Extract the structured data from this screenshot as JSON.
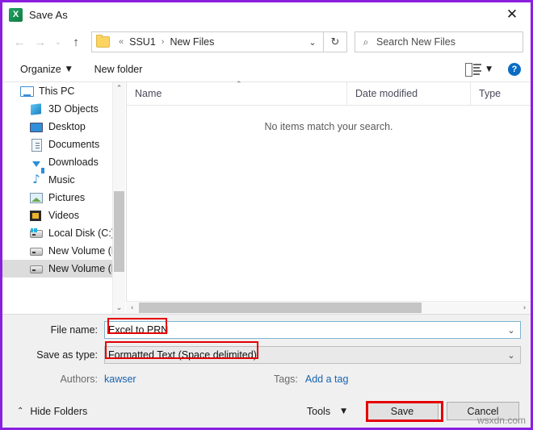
{
  "window": {
    "title": "Save As",
    "app_icon": "excel-icon",
    "app_icon_letter": "X",
    "close_label": "✕",
    "border_color": "#8B1FE0"
  },
  "navbar": {
    "back_icon": "←",
    "forward_icon": "→",
    "recent_icon": "⌄",
    "up_icon": "↑",
    "address": {
      "folder_icon": "folder-icon",
      "overflow": "«",
      "segments": [
        "SSU1",
        "New Files"
      ],
      "separator": "›",
      "caret": "⌄"
    },
    "refresh_icon": "↻",
    "search": {
      "icon": "⌕",
      "placeholder": "Search New Files",
      "value": ""
    }
  },
  "commandbar": {
    "organize_label": "Organize",
    "organize_caret": "▼",
    "new_folder_label": "New folder",
    "view_caret": "▼",
    "help_label": "?"
  },
  "sidebar": {
    "items": [
      {
        "label": "This PC",
        "icon": "pc-icon",
        "level": 0,
        "selected": false
      },
      {
        "label": "3D Objects",
        "icon": "3d-icon",
        "level": 1,
        "selected": false
      },
      {
        "label": "Desktop",
        "icon": "desktop-icon",
        "level": 1,
        "selected": false
      },
      {
        "label": "Documents",
        "icon": "document-icon",
        "level": 1,
        "selected": false
      },
      {
        "label": "Downloads",
        "icon": "download-icon",
        "level": 1,
        "selected": false
      },
      {
        "label": "Music",
        "icon": "music-icon",
        "level": 1,
        "selected": false
      },
      {
        "label": "Pictures",
        "icon": "picture-icon",
        "level": 1,
        "selected": false
      },
      {
        "label": "Videos",
        "icon": "video-icon",
        "level": 1,
        "selected": false
      },
      {
        "label": "Local Disk (C:)",
        "icon": "drive-icon",
        "level": 1,
        "selected": false
      },
      {
        "label": "New Volume (D:)",
        "icon": "drive-icon",
        "level": 1,
        "selected": false
      },
      {
        "label": "New Volume (E:)",
        "icon": "drive-icon",
        "level": 1,
        "selected": true
      }
    ],
    "scroll_up_icon": "⌃",
    "scroll_down_icon": "⌄"
  },
  "filelist": {
    "columns": [
      "Name",
      "Date modified",
      "Type"
    ],
    "sort_caret": "⌃",
    "empty_message": "No items match your search.",
    "rows": [],
    "hscroll_left_icon": "‹",
    "hscroll_right_icon": "›"
  },
  "form": {
    "filename_label": "File name:",
    "filename_value": "Excel to PRN",
    "savetype_label": "Save as type:",
    "savetype_value": "Formatted Text (Space delimited)",
    "caret": "⌄",
    "authors_label": "Authors:",
    "authors_value": "kawser",
    "tags_label": "Tags:",
    "tags_value": "Add a tag"
  },
  "footer": {
    "hide_folders_label": "Hide Folders",
    "hide_folders_caret": "⌃",
    "tools_label": "Tools",
    "tools_caret": "▼",
    "save_label": "Save",
    "cancel_label": "Cancel"
  },
  "watermark": "wsxdn.com",
  "annotations": {
    "color": "#e50000",
    "targets": [
      "filename-value",
      "savetype-value",
      "save-button"
    ]
  }
}
